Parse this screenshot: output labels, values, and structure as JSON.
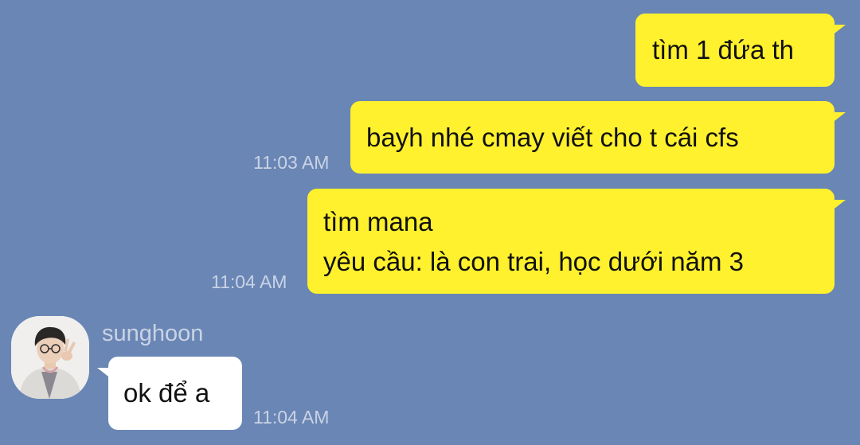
{
  "chat": {
    "messages": [
      {
        "from": "me",
        "lines": [
          "tìm 1 đứa th"
        ],
        "time": ""
      },
      {
        "from": "me",
        "lines": [
          "bayh nhé cmay viết cho t cái cfs"
        ],
        "time": "11:03 AM"
      },
      {
        "from": "me",
        "lines": [
          "tìm mana",
          "yêu cầu: là con trai, học dưới năm 3"
        ],
        "time": "11:04 AM"
      },
      {
        "from": "them",
        "sender": "sunghoon",
        "lines": [
          "ok để a"
        ],
        "time": "11:04 AM"
      }
    ]
  },
  "colors": {
    "background": "#6a86b4",
    "outgoing_bubble": "#fff12d",
    "incoming_bubble": "#ffffff",
    "timestamp": "#c9d3e6"
  },
  "icons": {
    "avatar": "user-avatar-photo"
  }
}
